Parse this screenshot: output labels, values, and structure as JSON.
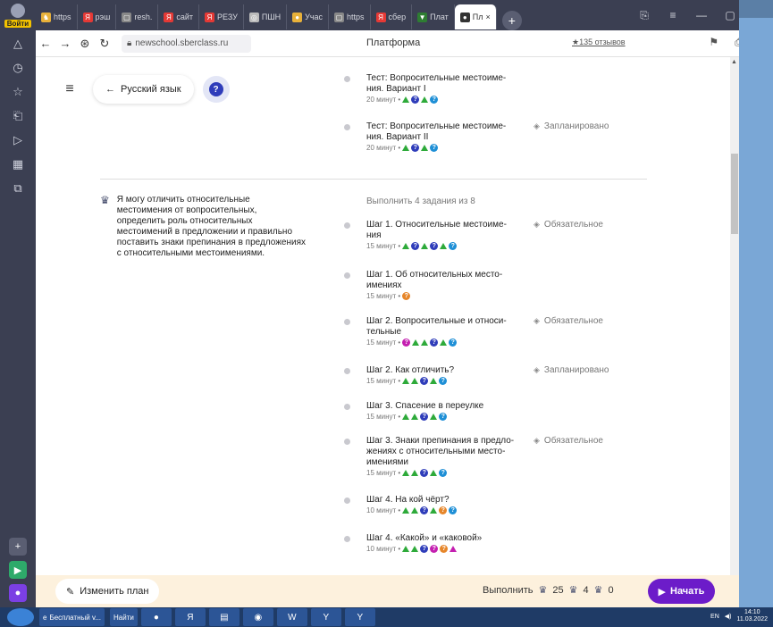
{
  "browser": {
    "login_label": "Войти",
    "tabs": [
      {
        "label": "https",
        "color": "#e8b13a",
        "glyph": "♞"
      },
      {
        "label": "рэш",
        "color": "#e53935",
        "glyph": "Я"
      },
      {
        "label": "resh.",
        "color": "#888888",
        "glyph": "▢"
      },
      {
        "label": "сайт",
        "color": "#e53935",
        "glyph": "Я"
      },
      {
        "label": "РЕЗУ",
        "color": "#e53935",
        "glyph": "Я"
      },
      {
        "label": "ПШН",
        "color": "#bbbbbb",
        "glyph": "◎"
      },
      {
        "label": "Учас",
        "color": "#e8b13a",
        "glyph": "●"
      },
      {
        "label": "https",
        "color": "#888888",
        "glyph": "▢"
      },
      {
        "label": "сбер",
        "color": "#e53935",
        "glyph": "Я"
      },
      {
        "label": "Плат",
        "color": "#2e7d32",
        "glyph": "▼"
      },
      {
        "label": "Пл",
        "color": "#333333",
        "glyph": "●",
        "active": true
      }
    ],
    "url": "newschool.sberclass.ru",
    "page_title": "Платформа",
    "reviews": "★135 отзывов"
  },
  "header": {
    "back_label": "Русский язык",
    "help_glyph": "?"
  },
  "top_items": [
    {
      "title": "Тест: Вопросительные местоиме-ния. Вариант I",
      "meta": "20 минут •",
      "status": ""
    },
    {
      "title": "Тест: Вопросительные местоиме-ния. Вариант II",
      "meta": "20 минут •",
      "status": "Запланировано"
    }
  ],
  "goal": {
    "text": "Я могу отличить относительные местоимения от вопросительных, определить роль относительных местоимений в предложении и правильно поставить знаки препинания в предложениях с относительными местоимениями."
  },
  "progress_label": "Выполнить 4 задания из 8",
  "steps": [
    {
      "title": "Шаг 1. Относительные местоиме-ния",
      "meta": "15 минут •",
      "status": "Обязательное"
    },
    {
      "title": "Шаг 1. Об относительных место-имениях",
      "meta": "15 минут •",
      "status": ""
    },
    {
      "title": "Шаг 2. Вопросительные и относи-тельные",
      "meta": "15 минут •",
      "status": "Обязательное"
    },
    {
      "title": "Шаг 2. Как отличить?",
      "meta": "15 минут •",
      "status": "Запланировано"
    },
    {
      "title": "Шаг 3. Спасение в переулке",
      "meta": "15 минут •",
      "status": ""
    },
    {
      "title": "Шаг 3. Знаки препинания в предло-жениях с относительными место-имениями",
      "meta": "15 минут •",
      "status": "Обязательное"
    },
    {
      "title": "Шаг 4. На кой чёрт?",
      "meta": "10 минут •",
      "status": ""
    },
    {
      "title": "Шаг 4. «Какой» и «каковой»",
      "meta": "10 минут •",
      "status": ""
    }
  ],
  "actionbar": {
    "edit_label": "Изменить план",
    "do_label": "Выполнить",
    "count_a": "25",
    "count_b": "4",
    "count_c": "0",
    "start_label": "Начать"
  },
  "taskbar": {
    "item_label": "Бесплатный v...",
    "search_label": "Найти",
    "lang": "EN",
    "time": "14:10",
    "date": "11.03.2022"
  },
  "colors": {
    "accent": "#6c1cc9",
    "help": "#2f3dba",
    "green": "#2eaa3a",
    "blue": "#1e8fd6",
    "dark_blue": "#2f3dba",
    "orange": "#e6862a",
    "magenta": "#c41fb0"
  }
}
